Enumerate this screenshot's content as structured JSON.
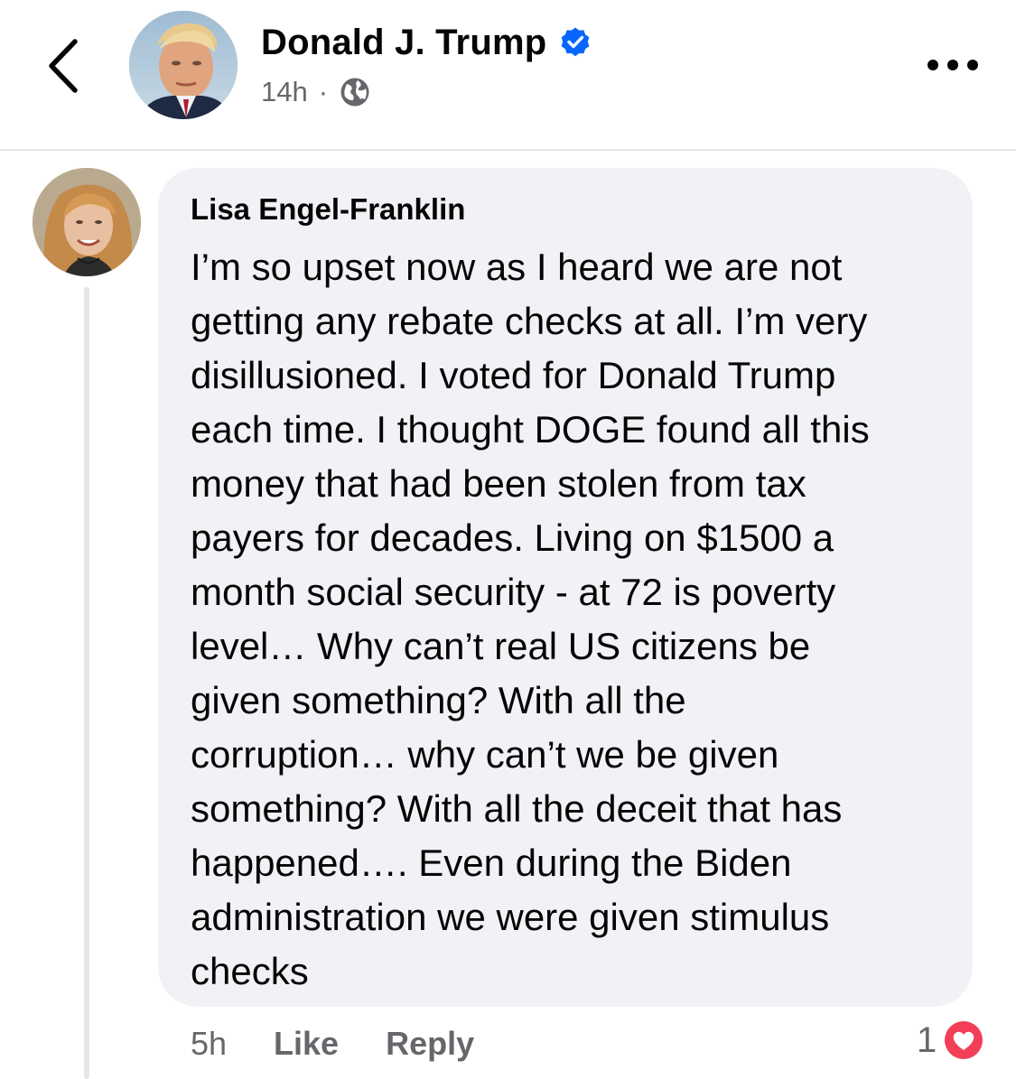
{
  "header": {
    "back_icon": "chevron-left-icon",
    "author_name": "Donald J. Trump",
    "verified_icon": "verified-badge-icon",
    "timestamp": "14h",
    "separator": "·",
    "audience_icon": "globe-icon",
    "more_icon": "more-horizontal-icon"
  },
  "comment": {
    "author": "Lisa Engel-Franklin",
    "text": "I’m so upset now as I heard we are not\ngetting any rebate checks at all. I’m very\ndisillusioned. I voted for Donald Trump\neach time. I thought DOGE found all this\nmoney that had been stolen from tax\npayers for decades. Living on $1500 a\nmonth social security - at 72 is poverty\nlevel… Why can’t real US citizens be\ngiven something? With all the\ncorruption… why can’t we be given\nsomething? With all the deceit that has\nhappened…. Even during the Biden\nadministration we were given stimulus\nchecks",
    "time": "5h",
    "like_label": "Like",
    "reply_label": "Reply",
    "reaction_count": "1",
    "reaction_icon": "love-reaction-icon"
  },
  "colors": {
    "text_primary": "#050505",
    "text_secondary": "#65676b",
    "bubble_bg": "#f0f2f5",
    "verified_blue": "#0866ff",
    "love_red": "#f33e58"
  }
}
